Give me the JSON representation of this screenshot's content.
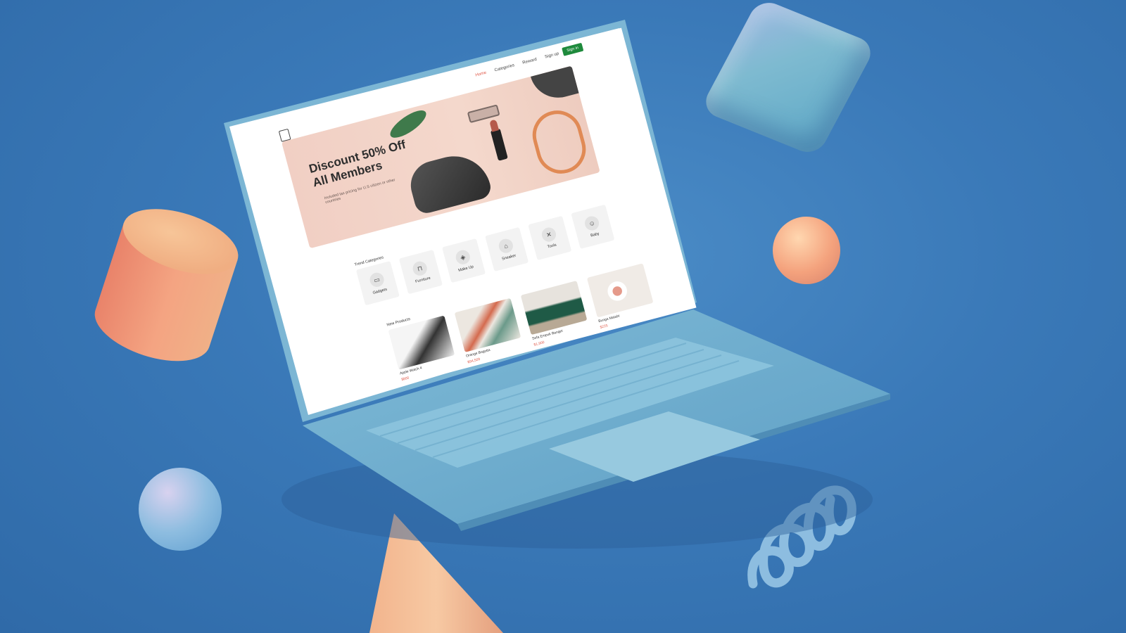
{
  "nav": {
    "links": [
      "Home",
      "Categories",
      "Reward",
      "Sign up"
    ],
    "signin": "Sign in"
  },
  "banner": {
    "title_line1": "Discount 50% Off",
    "title_line2": "All Members",
    "subtitle": "Included tax pricing for U.S citizen or other countries"
  },
  "trend_categories": {
    "title": "Trend Categories",
    "items": [
      {
        "label": "Gadgets",
        "icon": "monitor-icon"
      },
      {
        "label": "Furniture",
        "icon": "armchair-icon"
      },
      {
        "label": "Make Up",
        "icon": "makeup-icon"
      },
      {
        "label": "Sneaker",
        "icon": "sneaker-icon"
      },
      {
        "label": "Tools",
        "icon": "tools-icon"
      },
      {
        "label": "Baby",
        "icon": "baby-icon"
      }
    ]
  },
  "new_products": {
    "title": "New Products",
    "items": [
      {
        "name": "Apple Watch 4",
        "price": "$800",
        "color": "#3a3a3a"
      },
      {
        "name": "Orange Bogotta",
        "price": "$94,509",
        "color": "#e9e3dc"
      },
      {
        "name": "Sofa Empuk Banget",
        "price": "$1,900",
        "color": "#1f5a46"
      },
      {
        "name": "Bunga Matahi",
        "price": "$225",
        "color": "#f0ebe6"
      }
    ]
  },
  "colors": {
    "background": "#3a79b8",
    "laptop": "#74b1cf",
    "accent_red": "#e05a4a",
    "signin_green": "#1e8a3c"
  }
}
